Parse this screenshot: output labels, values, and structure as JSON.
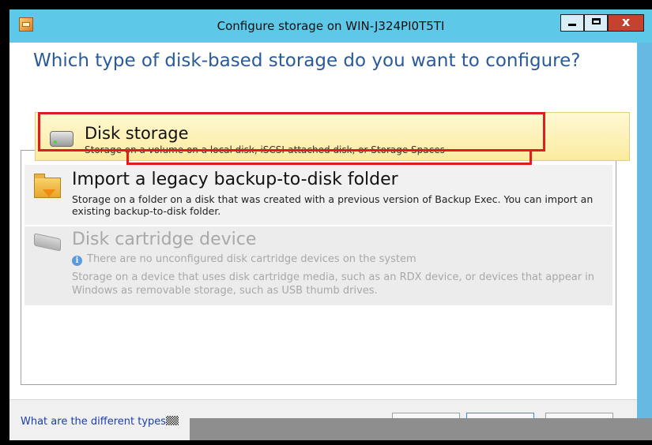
{
  "window": {
    "title": "Configure storage on WIN-J324PI0T5TI",
    "controls": {
      "minimize": "minimize",
      "maximize": "maximize",
      "close": "x"
    }
  },
  "header": {
    "question": "Which type of disk-based storage do you want to configure?"
  },
  "options": [
    {
      "id": "disk-storage",
      "title": "Disk storage",
      "description": "Storage on a volume on a local disk, iSCSI-attached disk, or Storage Spaces",
      "icon": "hard-disk-icon",
      "selected": true,
      "enabled": true
    },
    {
      "id": "import-legacy",
      "title": "Import a legacy backup-to-disk folder",
      "description": "Storage on a folder on a disk that was created with a previous version of Backup Exec.  You can import an existing backup-to-disk folder.",
      "icon": "folder-import-icon",
      "selected": false,
      "enabled": true
    },
    {
      "id": "disk-cartridge",
      "title": "Disk cartridge device",
      "note": "There are no unconfigured disk cartridge devices on the system",
      "description": "Storage on a device that uses disk cartridge media, such as an RDX device, or devices that appear in Windows as removable storage, such as USB thumb drives.",
      "icon": "disk-cartridge-icon",
      "selected": false,
      "enabled": false
    }
  ],
  "footer": {
    "help_link": "What are the different types"
  },
  "colors": {
    "titlebar": "#5ec8e8",
    "heading": "#2a5a9a",
    "selected_bg": "#fbeba0",
    "highlight_box": "#e01c1c",
    "link": "#1a3fa8"
  }
}
